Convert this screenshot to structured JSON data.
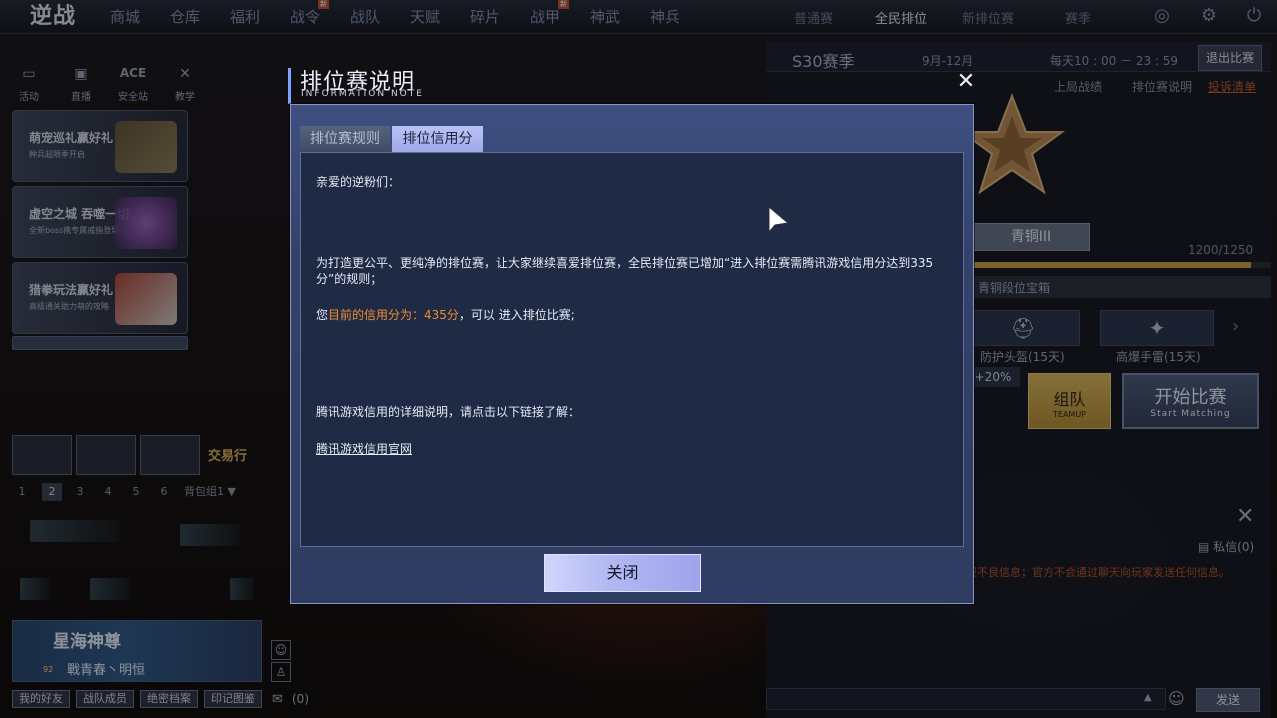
{
  "game": {
    "logo_text": "逆战"
  },
  "nav": {
    "items": [
      {
        "label": "商城",
        "new": false
      },
      {
        "label": "仓库",
        "new": false
      },
      {
        "label": "福利",
        "new": false
      },
      {
        "label": "战令",
        "new": true
      },
      {
        "label": "战队",
        "new": false
      },
      {
        "label": "天赋",
        "new": false
      },
      {
        "label": "碎片",
        "new": false
      },
      {
        "label": "战甲",
        "new": true
      },
      {
        "label": "神武",
        "new": false
      },
      {
        "label": "神兵",
        "new": false
      }
    ],
    "badge_new": "新"
  },
  "modes": [
    {
      "label": "普通赛",
      "active": false
    },
    {
      "label": "全民排位",
      "active": true
    },
    {
      "label": "新排位赛",
      "active": false
    },
    {
      "label": "赛季",
      "active": false
    }
  ],
  "left": {
    "quick_links": [
      {
        "label": "活动",
        "icon": "activity-icon"
      },
      {
        "label": "直播",
        "icon": "tv-icon"
      },
      {
        "label": "安全站",
        "icon": "ace-icon"
      },
      {
        "label": "教学",
        "icon": "tutorial-icon"
      }
    ],
    "promos": [
      {
        "title": "萌宠巡礼赢好礼",
        "sub": "种兵超限季开启"
      },
      {
        "title": "虚空之城 吞噬一切",
        "sub": "全新boss携专属戒指登场"
      },
      {
        "title": "猎拳玩法赢好礼",
        "sub": "高级通关助力萌的攻略"
      }
    ],
    "trade_label": "交易行",
    "slots": [
      "1",
      "2",
      "3",
      "4",
      "5",
      "6"
    ],
    "active_slot": "2",
    "backpack_group": "背包组1",
    "profile": {
      "name": "星海神尊",
      "sub": "戰青春丶明恒",
      "level": "92"
    },
    "bottom_buttons": [
      "我的好友",
      "战队成员",
      "绝密档案",
      "印记图鉴"
    ],
    "mail_count": "(0)"
  },
  "right": {
    "season": "S30赛季",
    "season_dates": "9月-12月",
    "daily_time": "每天10 : 00 － 23 : 59",
    "exit_label": "退出比赛",
    "links": [
      "上局战绩",
      "排位赛说明",
      "投诉清单"
    ],
    "rank_name": "青铜III",
    "rank_numeral": "III",
    "progress_text": "1200/1250",
    "progress_fraction": 0.96,
    "chest_label": "青铜段位宝箱",
    "rewards": [
      {
        "label": "防护头盔(15天)",
        "icon": "helmet-icon"
      },
      {
        "label": "高爆手雷(15天)",
        "icon": "grenade-icon"
      }
    ],
    "bonus": "+20%",
    "team_label": "组队",
    "team_sub": "TEAMUP",
    "start_label": "开始比赛",
    "start_sub": "Start Matching",
    "private_msg": "私信(0)",
    "chat_notice": "报不良信息；官方不会通过聊天向玩家发送任何信息。",
    "send_label": "发送"
  },
  "modal": {
    "title": "排位赛说明",
    "title_en": "INFORMATION NOTE",
    "tabs": [
      {
        "label": "排位赛规则",
        "active": false
      },
      {
        "label": "排位信用分",
        "active": true
      }
    ],
    "greeting": "亲爱的逆粉们：",
    "para1_line1": "为打造更公平、更纯净的排位赛，让大家继续喜爱排位赛，全民排位赛已增加“进入排位赛需腾讯游戏信用分达到335",
    "para1_line2": "分”的规则；",
    "score_prefix": "您",
    "score_highlight": "目前的信用分为：435分",
    "score_suffix": "，可以 进入排位比赛;",
    "link_intro": "腾讯游戏信用的详细说明，请点击以下链接了解：",
    "link_text": "腾讯游戏信用官网",
    "close_label": "关闭"
  },
  "colors": {
    "accent_orange": "#ee8c34",
    "tab_active": "#aab3f1",
    "gold_button": "#c9a44f"
  }
}
